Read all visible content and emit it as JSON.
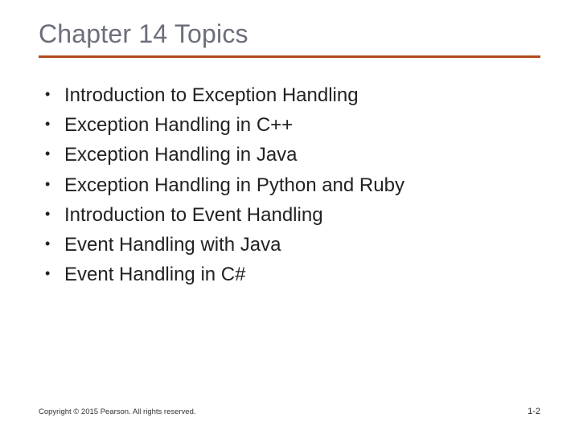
{
  "title": "Chapter 14 Topics",
  "accent_color": "#b24a1a",
  "bullets": [
    "Introduction to Exception Handling",
    "Exception Handling in C++",
    "Exception Handling in Java",
    "Exception Handling in Python and Ruby",
    "Introduction to Event Handling",
    "Event Handling with Java",
    "Event Handling in C#"
  ],
  "footer": {
    "copyright": "Copyright © 2015 Pearson. All rights reserved.",
    "page": "1-2"
  }
}
